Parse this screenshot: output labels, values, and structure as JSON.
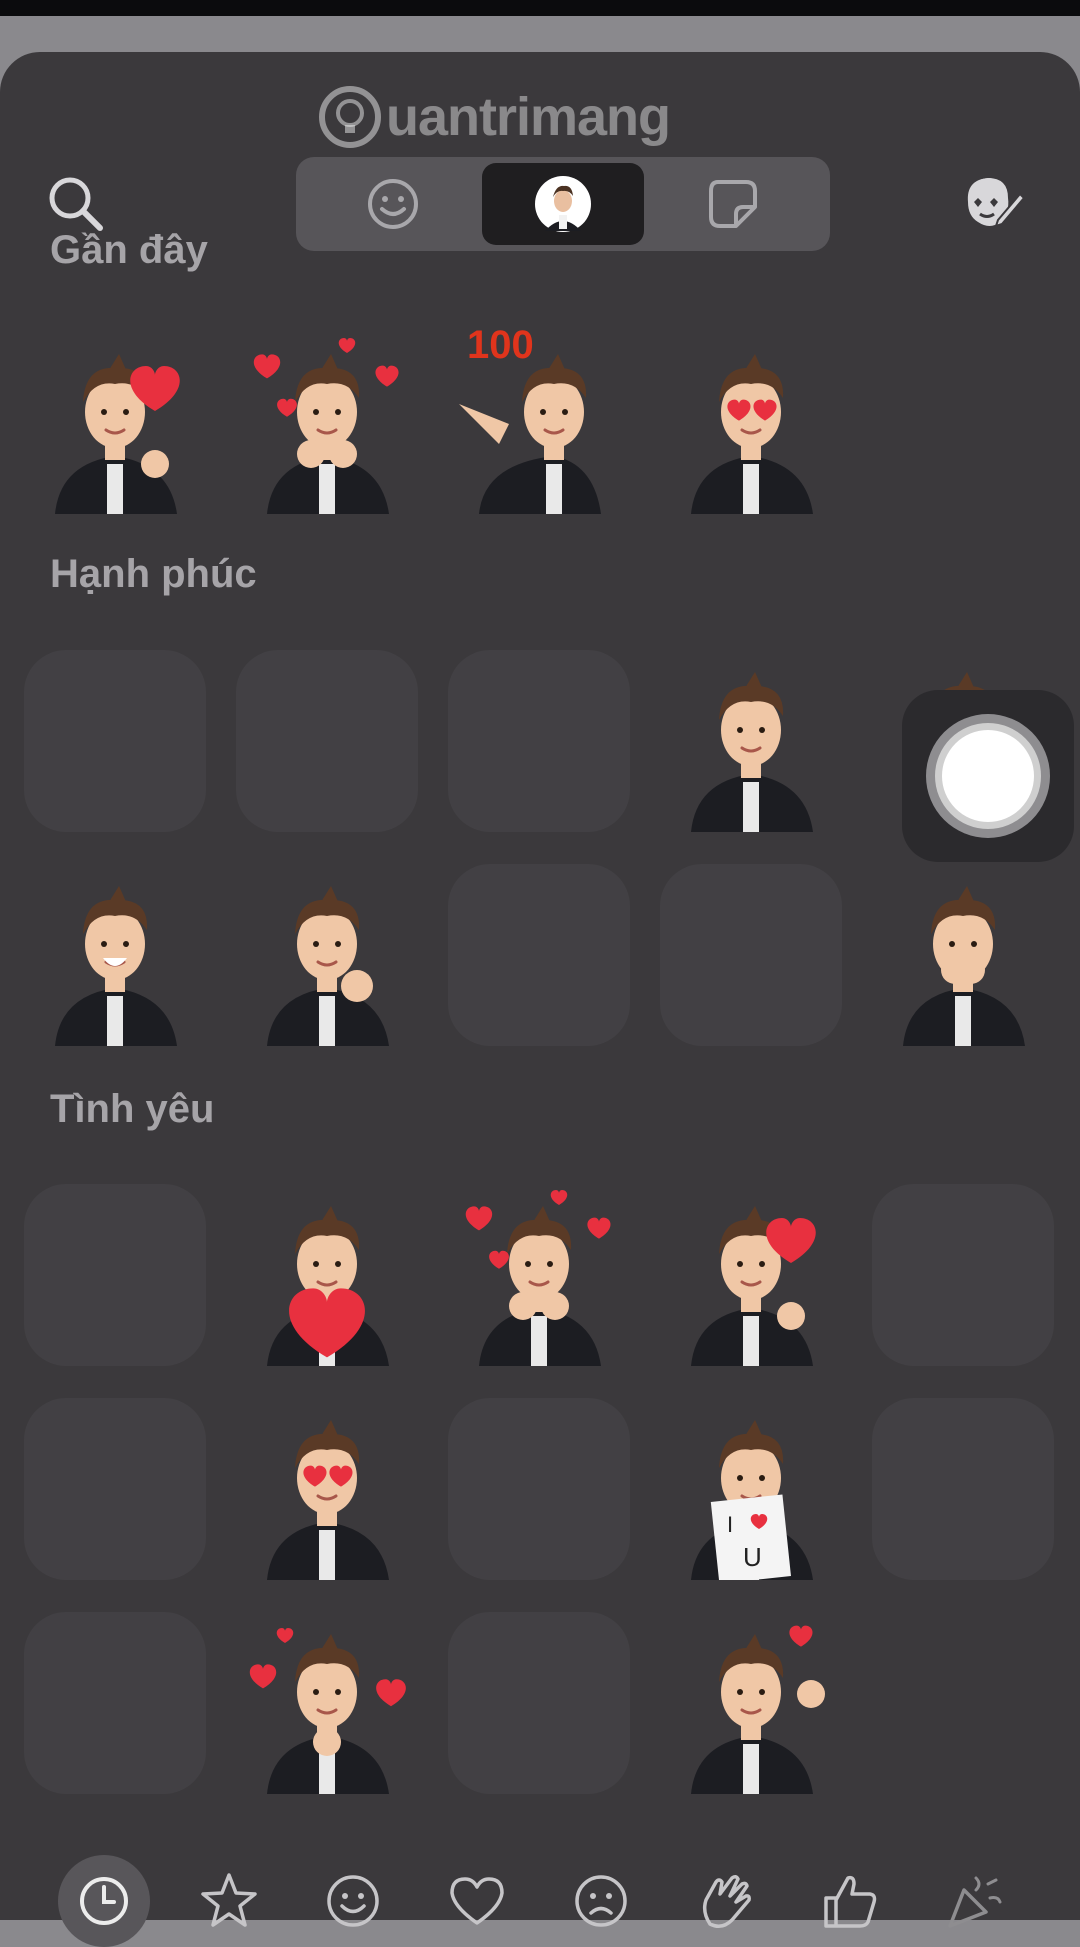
{
  "watermark": {
    "text": "uantrimang"
  },
  "top_bar": {
    "search_icon": "search-icon",
    "segments": [
      {
        "icon": "smiley-icon",
        "selected": false
      },
      {
        "icon": "memoji-avatar-icon",
        "selected": true
      },
      {
        "icon": "sticker-icon",
        "selected": false
      }
    ],
    "edit_icon": "memoji-edit-icon"
  },
  "sections": [
    {
      "title": "Gần đây"
    },
    {
      "title": "Hạnh phúc"
    },
    {
      "title": "Tình yêu"
    }
  ],
  "category_bar": {
    "items": [
      {
        "icon": "clock-icon",
        "active": true
      },
      {
        "icon": "star-icon",
        "active": false
      },
      {
        "icon": "smile-icon",
        "active": false
      },
      {
        "icon": "heart-icon",
        "active": false
      },
      {
        "icon": "sad-face-icon",
        "active": false
      },
      {
        "icon": "clapping-hands-icon",
        "active": false
      },
      {
        "icon": "thumbs-up-icon",
        "active": false
      },
      {
        "icon": "party-icon",
        "active": false
      }
    ]
  },
  "colors": {
    "sheet": "#3b393c",
    "placeholder": "#424044",
    "heart": "#e8303f",
    "jacket": "#1c1d22",
    "skin": "#f0c7a6",
    "hair": "#5a3a26"
  }
}
